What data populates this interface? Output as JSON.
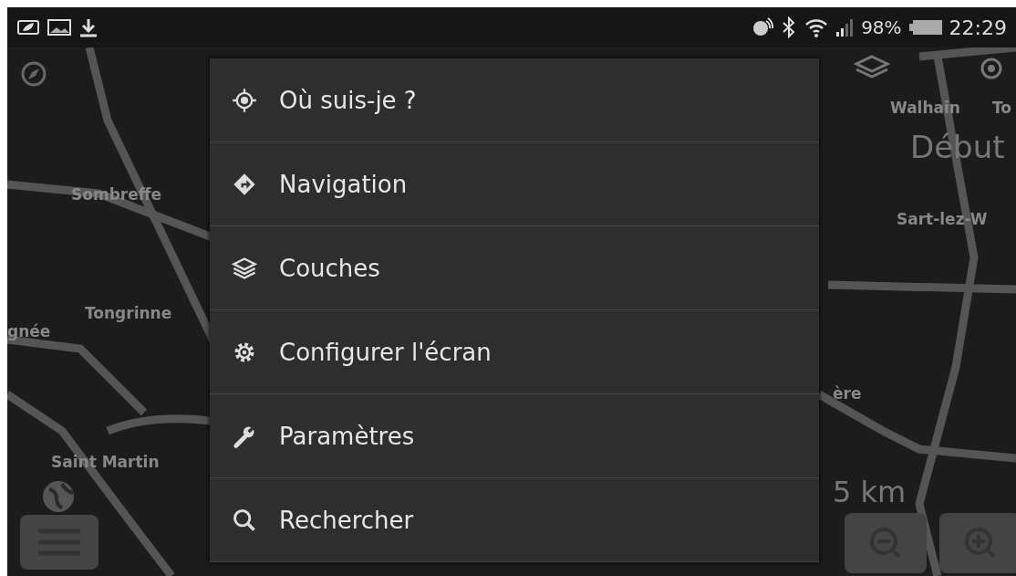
{
  "status_bar": {
    "battery_percent": "98%",
    "time": "22:29"
  },
  "map": {
    "labels": [
      {
        "text": "Sombreffe",
        "kind": "town"
      },
      {
        "text": "Tongrinne",
        "kind": "town"
      },
      {
        "text": "gnée",
        "kind": "town"
      },
      {
        "text": "Saint Martin",
        "kind": "town"
      },
      {
        "text": "Walhain",
        "kind": "town"
      },
      {
        "text": "To",
        "kind": "town"
      },
      {
        "text": "Début",
        "kind": "marker"
      },
      {
        "text": "Sart-lez-W",
        "kind": "town"
      },
      {
        "text": "ère",
        "kind": "town"
      },
      {
        "text": "5 km",
        "kind": "distance"
      }
    ]
  },
  "menu": {
    "items": [
      {
        "label": "Où suis-je ?",
        "kind": "location"
      },
      {
        "label": "Navigation",
        "kind": "directions"
      },
      {
        "label": "Couches",
        "kind": "layers"
      },
      {
        "label": "Configurer l'écran",
        "kind": "gear"
      },
      {
        "label": "Paramètres",
        "kind": "wrench"
      },
      {
        "label": "Rechercher",
        "kind": "search"
      }
    ]
  }
}
